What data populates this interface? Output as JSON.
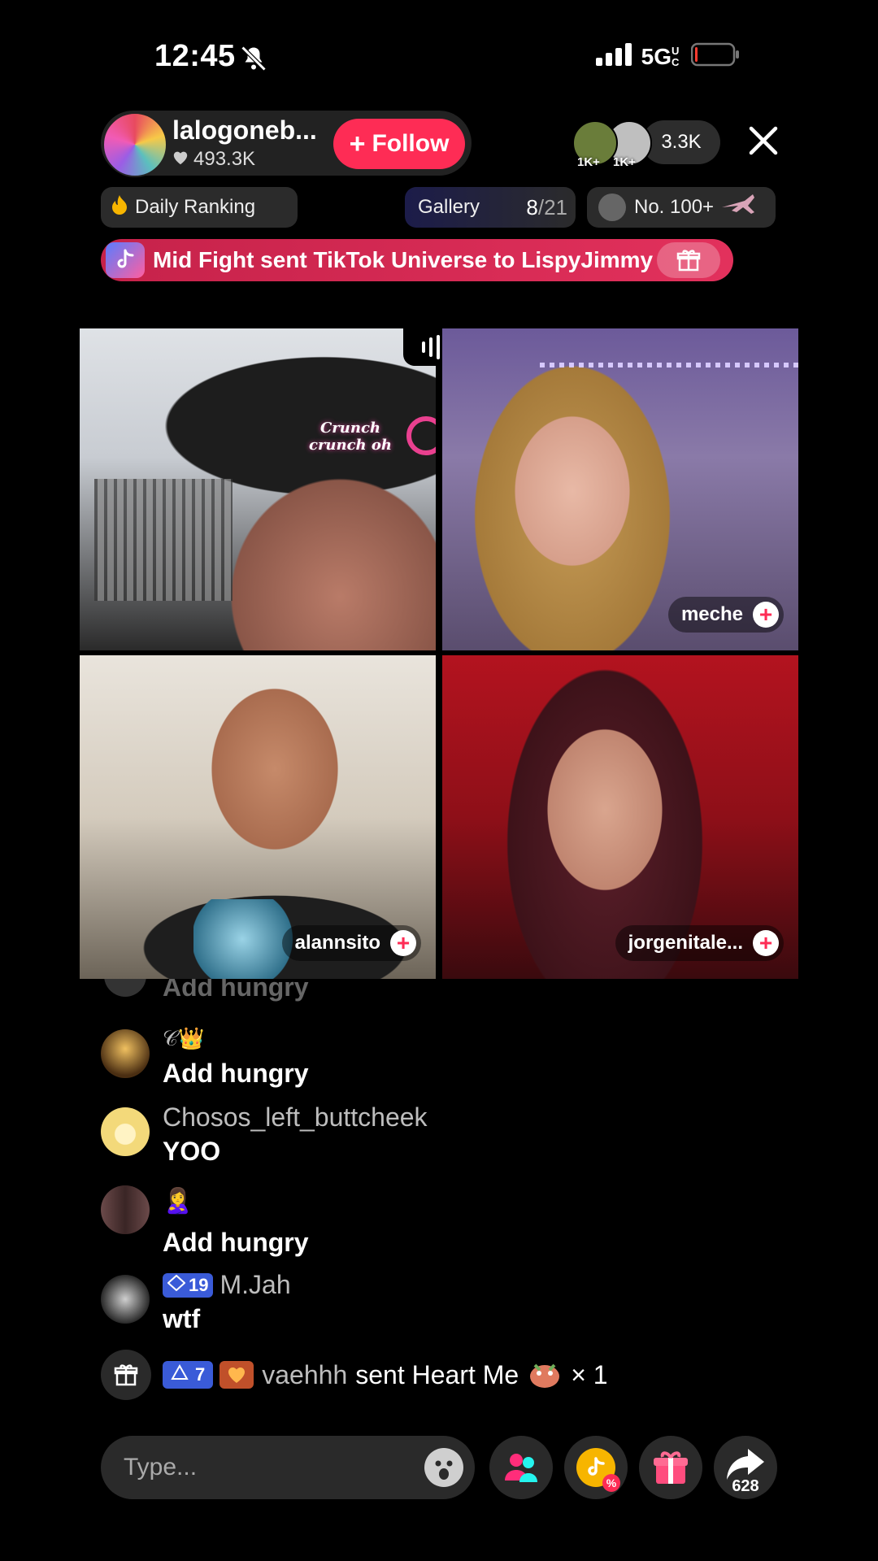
{
  "status_bar": {
    "time": "12:45",
    "network": "5G",
    "network_suffix": "UC",
    "icons": [
      "bell-slash-icon",
      "signal-icon",
      "battery-icon"
    ]
  },
  "host": {
    "name": "lalogoneb...",
    "likes": "493.3K",
    "follow_label": "Follow"
  },
  "viewers": {
    "avatars": [
      {
        "badge": "1K+",
        "color": "#6a7d3a"
      },
      {
        "badge": "1K+",
        "color": "#bfbfbf"
      }
    ],
    "count": "3.3K"
  },
  "chips": {
    "daily_ranking": "Daily Ranking",
    "gallery": "Gallery",
    "gallery_progress": "8",
    "gallery_total": "/21",
    "rank": "No. 100+"
  },
  "banner": {
    "text": "Mid Fight sent TikTok Universe to LispyJimmy"
  },
  "video_grid": {
    "tiles": [
      {
        "name": "",
        "overlay_text": "Crunch crunch oh"
      },
      {
        "name": "meche"
      },
      {
        "name": "alannsito"
      },
      {
        "name": "jorgenitale..."
      }
    ]
  },
  "chat": {
    "faded_message": "Add hungry",
    "messages": [
      {
        "user": "𝒞👑",
        "text": "Add hungry",
        "avatar_color": "#4a2e12"
      },
      {
        "user": "Chosos_left_buttcheek",
        "text": "YOO",
        "avatar_color": "#f3d97a"
      },
      {
        "user": "🙎‍♀️",
        "text": "Add hungry",
        "avatar_color": "#5a3a3a"
      },
      {
        "user": "M.Jah",
        "text": "wtf",
        "level": "19",
        "avatar_color": "#555555"
      }
    ],
    "gift_notice": {
      "level": "7",
      "user": "vaehhh",
      "text": "sent Heart Me",
      "count": "× 1"
    }
  },
  "bottom_bar": {
    "input_placeholder": "Type...",
    "share_count": "628"
  },
  "colors": {
    "accent": "#fe2c55",
    "background": "#000000"
  }
}
